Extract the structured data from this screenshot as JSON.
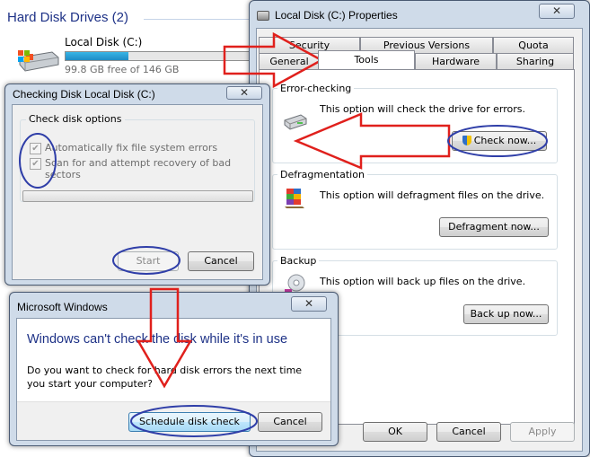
{
  "explorer": {
    "section_heading": "Hard Disk Drives (2)",
    "drive": {
      "name": "Local Disk (C:)",
      "free_text": "99.8 GB free of 146 GB",
      "used_fraction": 0.32,
      "icon": "hard-drive-icon"
    }
  },
  "properties": {
    "title": "Local Disk (C:) Properties",
    "close_label": "✕",
    "tabs_back": [
      "Security",
      "Previous Versions",
      "Quota"
    ],
    "tabs_front": [
      "General",
      "Tools",
      "Hardware",
      "Sharing"
    ],
    "active_tab": "Tools",
    "error_checking": {
      "label": "Error-checking",
      "text": "This option will check the drive for errors.",
      "button": "Check now..."
    },
    "defragmentation": {
      "label": "Defragmentation",
      "text": "This option will defragment files on the drive.",
      "button": "Defragment now..."
    },
    "backup": {
      "label": "Backup",
      "text": "This option will back up files on the drive.",
      "button": "Back up now..."
    },
    "footer_buttons": {
      "ok": "OK",
      "cancel": "Cancel",
      "apply": "Apply"
    }
  },
  "checkdisk": {
    "title": "Checking Disk Local Disk (C:)",
    "close_label": "✕",
    "options_label": "Check disk options",
    "option1": "Automatically fix file system errors",
    "option2": "Scan for and attempt recovery of bad sectors",
    "start": "Start",
    "cancel": "Cancel",
    "progress": 0
  },
  "msgbox": {
    "title": "Microsoft Windows",
    "close_label": "✕",
    "main_instruction": "Windows can't check the disk while it's in use",
    "body": "Do you want to check for hard disk errors the next time you start your computer?",
    "schedule": "Schedule disk check",
    "cancel": "Cancel"
  },
  "annotation_colors": {
    "arrow": "#e0201c",
    "ellipse": "#2f3ea8"
  }
}
